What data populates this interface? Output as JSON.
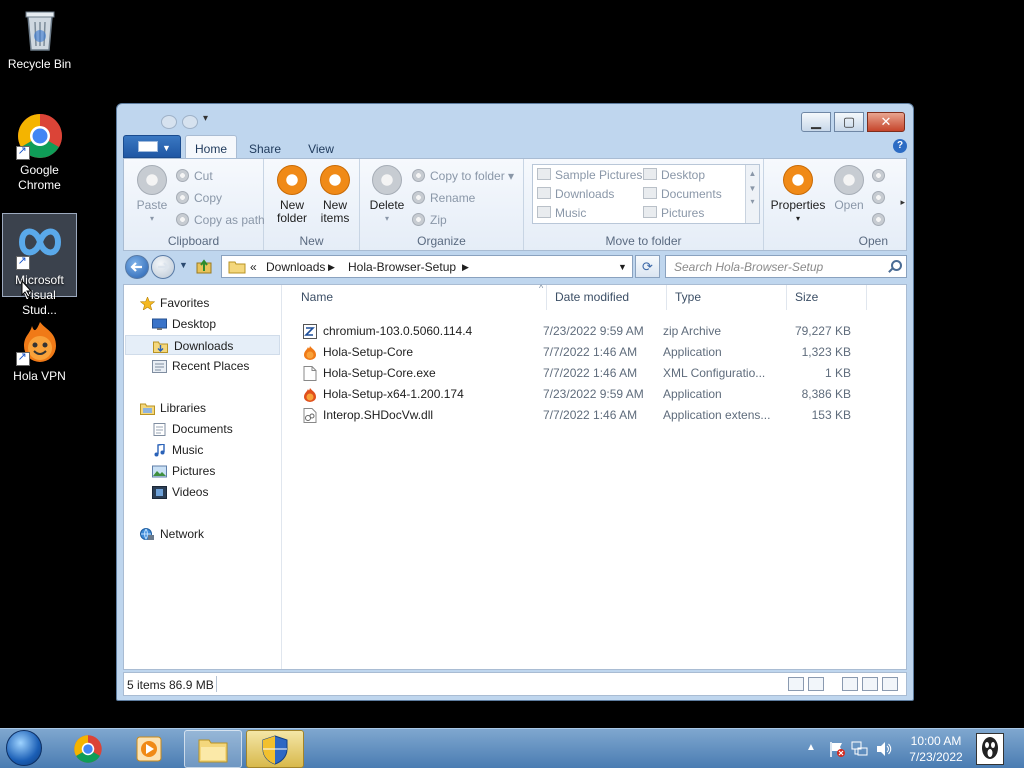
{
  "desktop": {
    "icons": [
      {
        "label": "Recycle Bin"
      },
      {
        "label": "Google Chrome"
      },
      {
        "label": "Microsoft Visual Stud..."
      },
      {
        "label": "Hola VPN"
      }
    ]
  },
  "ribbon": {
    "tabs": [
      "Home",
      "Share",
      "View"
    ],
    "active_tab": "Home",
    "clipboard": {
      "label": "Clipboard",
      "paste": "Paste",
      "cut": "Cut",
      "copy": "Copy",
      "copy_as_path": "Copy as path"
    },
    "new": {
      "label": "New",
      "new_folder": "New folder",
      "new_items": "New items"
    },
    "organize": {
      "label": "Organize",
      "delete": "Delete",
      "copy_to_folder": "Copy to folder",
      "rename": "Rename",
      "zip": "Zip"
    },
    "move_to_folder": {
      "label": "Move to folder",
      "items": [
        "Sample Pictures",
        "Desktop",
        "Downloads",
        "Documents",
        "Music",
        "Pictures"
      ]
    },
    "open": {
      "label": "Open",
      "properties": "Properties",
      "open": "Open"
    }
  },
  "address": {
    "prefix": "«",
    "crumbs": [
      "Downloads",
      "Hola-Browser-Setup"
    ],
    "search_placeholder": "Search Hola-Browser-Setup"
  },
  "nav": {
    "favorites": {
      "label": "Favorites",
      "items": [
        "Desktop",
        "Downloads",
        "Recent Places"
      ],
      "selected": "Downloads"
    },
    "libraries": {
      "label": "Libraries",
      "items": [
        "Documents",
        "Music",
        "Pictures",
        "Videos"
      ]
    },
    "network": {
      "label": "Network"
    }
  },
  "files": {
    "columns": [
      "Name",
      "Date modified",
      "Type",
      "Size"
    ],
    "rows": [
      {
        "name": "chromium-103.0.5060.114.4",
        "date": "7/23/2022 9:59 AM",
        "type": "zip Archive",
        "size": "79,227 KB",
        "icon": "zip-icon"
      },
      {
        "name": "Hola-Setup-Core",
        "date": "7/7/2022 1:46 AM",
        "type": "Application",
        "size": "1,323 KB",
        "icon": "hola-app-icon"
      },
      {
        "name": "Hola-Setup-Core.exe",
        "date": "7/7/2022 1:46 AM",
        "type": "XML Configuratio...",
        "size": "1 KB",
        "icon": "file-icon"
      },
      {
        "name": "Hola-Setup-x64-1.200.174",
        "date": "7/23/2022 9:59 AM",
        "type": "Application",
        "size": "8,386 KB",
        "icon": "hola-app-icon"
      },
      {
        "name": "Interop.SHDocVw.dll",
        "date": "7/7/2022 1:46 AM",
        "type": "Application extens...",
        "size": "153 KB",
        "icon": "dll-icon"
      }
    ]
  },
  "status": {
    "text": "5 items  86.9 MB"
  },
  "taskbar": {
    "time": "10:00 AM",
    "date": "7/23/2022"
  },
  "colors": {
    "accent": "#1f57a4",
    "orange": "#f08a17",
    "window_frame": "#bfd6ee"
  }
}
